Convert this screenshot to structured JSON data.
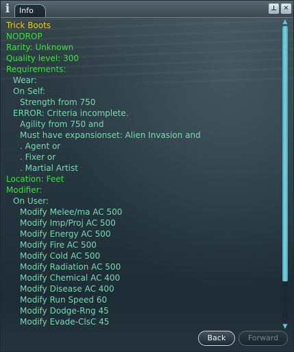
{
  "window": {
    "info_glyph": "i",
    "tab_label": "Info",
    "pin_glyph": "⊥",
    "close_glyph": "✕"
  },
  "lines": [
    {
      "text": "Trick Boots",
      "color": "yellow",
      "indent": 0
    },
    {
      "text": "NODROP",
      "color": "green",
      "indent": 0
    },
    {
      "text": "Rarity: Unknown",
      "color": "green",
      "indent": 0
    },
    {
      "text": "Quality level: 300",
      "color": "green",
      "indent": 0
    },
    {
      "text": "Requirements:",
      "color": "green",
      "indent": 0
    },
    {
      "text": "Wear:",
      "color": "teal",
      "indent": 1
    },
    {
      "text": "On Self:",
      "color": "teal",
      "indent": 1
    },
    {
      "text": "Strength from 750",
      "color": "teal",
      "indent": 2
    },
    {
      "text": "ERROR: Criteria incomplete.",
      "color": "teal",
      "indent": 1
    },
    {
      "text": "Agility from 750 and",
      "color": "teal",
      "indent": 2
    },
    {
      "text": "Must have expansionset: Alien Invasion and",
      "color": "teal",
      "indent": 2
    },
    {
      "text": ". Agent or",
      "color": "teal",
      "indent": 2
    },
    {
      "text": ". Fixer or",
      "color": "teal",
      "indent": 2
    },
    {
      "text": ". Martial Artist",
      "color": "teal",
      "indent": 2
    },
    {
      "text": "Location: Feet",
      "color": "green",
      "indent": 0
    },
    {
      "text": "Modifier:",
      "color": "green",
      "indent": 0
    },
    {
      "text": "On User:",
      "color": "teal",
      "indent": 1
    },
    {
      "text": "Modify Melee/ma AC 500",
      "color": "teal",
      "indent": 2
    },
    {
      "text": "Modify Imp/Proj AC 500",
      "color": "teal",
      "indent": 2
    },
    {
      "text": "Modify Energy AC 500",
      "color": "teal",
      "indent": 2
    },
    {
      "text": "Modify Fire AC 500",
      "color": "teal",
      "indent": 2
    },
    {
      "text": "Modify Cold AC 500",
      "color": "teal",
      "indent": 2
    },
    {
      "text": "Modify Radiation AC 500",
      "color": "teal",
      "indent": 2
    },
    {
      "text": "Modify Chemical AC 400",
      "color": "teal",
      "indent": 2
    },
    {
      "text": "Modify Disease AC 400",
      "color": "teal",
      "indent": 2
    },
    {
      "text": "Modify Run Speed 60",
      "color": "teal",
      "indent": 2
    },
    {
      "text": "Modify Dodge-Rng 45",
      "color": "teal",
      "indent": 2
    },
    {
      "text": "Modify Evade-ClsC 45",
      "color": "teal",
      "indent": 2
    }
  ],
  "scrollbar": {
    "up_glyph": "▲",
    "down_glyph": "▼",
    "visible_fraction": 0.86,
    "position_fraction": 0.0
  },
  "buttons": {
    "back_label": "Back",
    "forward_label": "Forward"
  },
  "colors": {
    "title_yellow": "#e2d21e",
    "label_green": "#3fdc46",
    "detail_teal": "#7bd8b0",
    "scroll_accent": "#7fd2e0"
  }
}
